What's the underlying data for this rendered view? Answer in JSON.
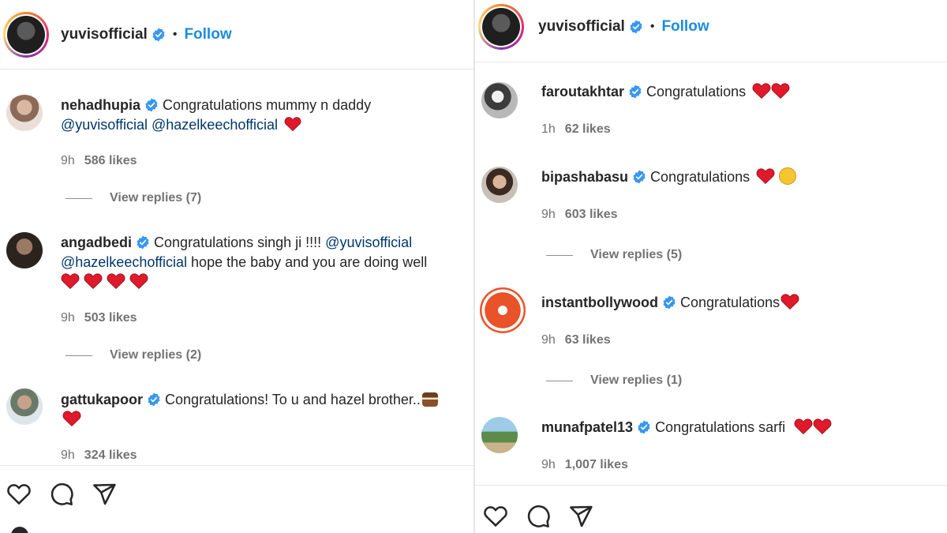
{
  "left": {
    "header": {
      "username": "yuvisofficial",
      "dot": "•",
      "follow": "Follow"
    },
    "comments": [
      {
        "username": "nehadhupia",
        "text1": "Congratulations mummy n daddy",
        "mention1": "@yuvisofficial",
        "mention2": "@hazelkeechofficial",
        "time": "9h",
        "likes": "586 likes",
        "replies": "View replies (7)"
      },
      {
        "username": "angadbedi",
        "text1": "Congratulations singh ji !!!!",
        "mention1": "@yuvisofficial",
        "mention2": "@hazelkeechofficial",
        "text2": "hope the baby and you are doing well",
        "time": "9h",
        "likes": "503 likes",
        "replies": "View replies (2)"
      },
      {
        "username": "gattukapoor",
        "text1": "Congratulations! To u and hazel brother..",
        "time": "9h",
        "likes": "324 likes"
      }
    ]
  },
  "right": {
    "header": {
      "username": "yuvisofficial",
      "dot": "•",
      "follow": "Follow"
    },
    "comments": [
      {
        "username": "faroutakhtar",
        "text1": "Congratulations",
        "time": "1h",
        "likes": "62 likes"
      },
      {
        "username": "bipashabasu",
        "text1": "Congratulations",
        "time": "9h",
        "likes": "603 likes",
        "replies": "View replies (5)"
      },
      {
        "username": "instantbollywood",
        "text1": "Congratulations",
        "time": "9h",
        "likes": "63 likes",
        "replies": "View replies (1)"
      },
      {
        "username": "munafpatel13",
        "text1": "Congratulations sarfi",
        "time": "9h",
        "likes": "1,007 likes"
      }
    ]
  },
  "icons": {
    "heart": "heart-icon",
    "comment": "comment-icon",
    "share": "share-icon",
    "verified": "verified-badge-icon"
  },
  "colors": {
    "follow": "#1a8de0",
    "mention": "#00376b",
    "verified": "#3897f0",
    "heart": "#e01a2b"
  }
}
